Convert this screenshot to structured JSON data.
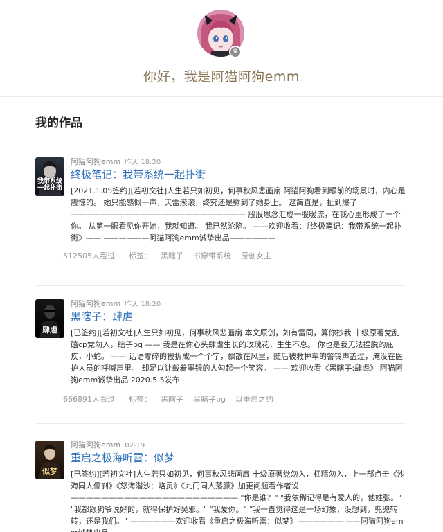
{
  "profile": {
    "greeting": "你好，我是阿猫阿狗emm",
    "avatar_badge_icon": "crown-icon"
  },
  "section": {
    "title": "我的作品"
  },
  "works": [
    {
      "author": "阿猫阿狗emm",
      "time": "昨天 18:20",
      "title": "终极笔记：我带系统一起扑街",
      "cover_text": "我带系统一起扑街",
      "description": "[2021.1.05签约][若初文社]人生若只如初见，何事秋风悲画扇 阿猫阿狗看到眼前的场景时，内心是震惊的。 她只能感慨一声，天雷滚滚，终究还是劈到了她身上。 这简直是，扯到爆了——————————————————————— 股股思念汇成一股暖流，在我心里形成了一个你。 从第一眼看见你开始，我就知道。 我已然沦陷。 ——欢迎收看：《终极笔记：我带系统一起扑街》—— ——————阿猫阿狗emm诚挚出品——————",
      "views": "512505人看过",
      "tags_label": "标签：",
      "tags": [
        "黑瞎子",
        "书穿带系统",
        "原创女主"
      ]
    },
    {
      "author": "阿猫阿狗emm",
      "time": "昨天 18:20",
      "title": "黑瞎子：肆虐",
      "cover_text": "肆虐",
      "description": "[已签约][若初文社]人生只如初见，何事秋风悲画扇 本文原创，如有雷同，算你抄我 十级原著党乱磕cp党勿入，瞎子bg —— 我是在你心头肆虐生长的玫瑰花，生生不息。 你也是我无法捏脱的庇疾，小蛇。 —— 话语零碎的被拆成一个个字，飘散在风里，随后被救护车的警铃声盖过，淹没在医护人员的呼喊声里。 却足以让戴着墨镜的人勾起一个笑容。 —— 欢迎收看《黑瞎子:肆虐》 阿猫阿狗emm诚挚出品 2020.5.5发布",
      "views": "666891人看过",
      "tags_label": "标签：",
      "tags": [
        "黑瞎子",
        "黑瞎子bg",
        "以重启之约"
      ]
    },
    {
      "author": "阿猫阿狗emm",
      "time": "02-19",
      "title": "重启之极海听雷：似梦",
      "cover_text": "似梦",
      "description": "[已签约][若初文社]人生若只如初见，何事秋风悲画扇 十级原著党勿入，杠精勿入，上一部点击《沙海同人儒刹》《怒海潜沙：烙灵》《九门同人落朦》加更问题看作者说. —————————————————————— \"你是谁？\" \"我依稀记得是有爱人的，他姓张。\" \"我都跟狗爷说好的，就得保护好吴邪。\" \"我爱你。\" \"我一直觉得这是一场幻象，没想到，兜兜转转，还是我们。\" ——————欢迎收看《重启之极海听雷：似梦》—————— ——阿猫阿狗emm诚挚出品——"
    }
  ]
}
